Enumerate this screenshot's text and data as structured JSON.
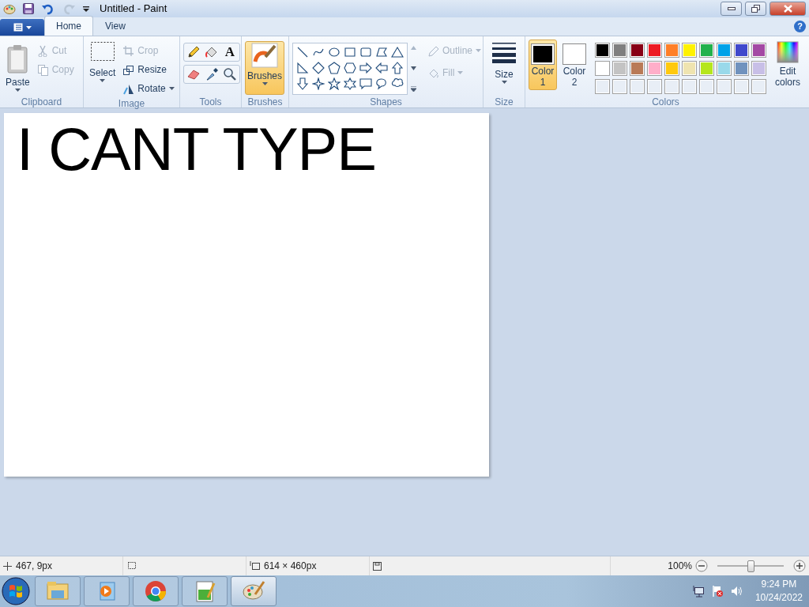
{
  "window": {
    "title": "Untitled - Paint",
    "redo_disabled": true
  },
  "tabs": [
    {
      "label": "Home",
      "selected": true
    },
    {
      "label": "View",
      "selected": false
    }
  ],
  "help_glyph": "?",
  "clipboard": {
    "label": "Clipboard",
    "paste": "Paste",
    "items": [
      {
        "label": "Cut",
        "kind": "cut",
        "disabled": true
      },
      {
        "label": "Copy",
        "kind": "copy",
        "disabled": true
      }
    ]
  },
  "image": {
    "label": "Image",
    "select": "Select",
    "items": [
      {
        "label": "Crop",
        "kind": "crop",
        "disabled": true
      },
      {
        "label": "Resize",
        "kind": "resize",
        "disabled": false
      },
      {
        "label": "Rotate",
        "kind": "rotate",
        "disabled": false
      }
    ]
  },
  "tools": {
    "label": "Tools",
    "items": [
      {
        "kind": "pencil",
        "selected": false
      },
      {
        "kind": "fill",
        "selected": false
      },
      {
        "kind": "text",
        "glyph": "A",
        "selected": false
      },
      {
        "kind": "eraser",
        "selected": false
      },
      {
        "kind": "picker",
        "selected": false
      },
      {
        "kind": "magnifier",
        "selected": false
      }
    ]
  },
  "brushes": {
    "label": "Brushes",
    "selected": true,
    "group_label": "Brushes"
  },
  "shapes": {
    "label": "Shapes",
    "options": [
      {
        "label": "Outline",
        "kind": "outline",
        "disabled": true
      },
      {
        "label": "Fill",
        "kind": "fill",
        "disabled": true
      }
    ]
  },
  "size": {
    "label": "Size",
    "group_label": "Size"
  },
  "colors": {
    "label": "Colors",
    "active": [
      {
        "label": "Color 1",
        "color": "#000000",
        "selected": true
      },
      {
        "label": "Color 2",
        "color": "#ffffff",
        "selected": false
      }
    ],
    "palette": [
      {
        "color": "#000000"
      },
      {
        "color": "#7f7f7f"
      },
      {
        "color": "#880015"
      },
      {
        "color": "#ed1c24"
      },
      {
        "color": "#ff7f27"
      },
      {
        "color": "#fff200"
      },
      {
        "color": "#22b14c"
      },
      {
        "color": "#00a2e8"
      },
      {
        "color": "#3f48cc"
      },
      {
        "color": "#a349a4"
      },
      {
        "color": "#ffffff"
      },
      {
        "color": "#c3c3c3"
      },
      {
        "color": "#b97a57"
      },
      {
        "color": "#ffaec9"
      },
      {
        "color": "#ffc90e"
      },
      {
        "color": "#efe4b0"
      },
      {
        "color": "#b5e61d"
      },
      {
        "color": "#99d9ea"
      },
      {
        "color": "#7092be"
      },
      {
        "color": "#c8bfe7"
      }
    ],
    "edit": "Edit colors"
  },
  "canvas": {
    "drawing_text": "I CANT TYPE"
  },
  "status_bar": {
    "cursor_position": "467, 9px",
    "image_size": "614 × 460px",
    "zoom": "100%",
    "zoom_slider": {
      "level": 0.5
    }
  },
  "taskbar": {
    "apps": [
      {
        "kind": "folder",
        "selected": false
      },
      {
        "kind": "media",
        "selected": false
      },
      {
        "kind": "browser",
        "selected": false
      },
      {
        "kind": "notepad",
        "selected": false
      },
      {
        "kind": "paint",
        "selected": true
      }
    ],
    "time": "9:24 PM",
    "date": "10/24/2022"
  }
}
